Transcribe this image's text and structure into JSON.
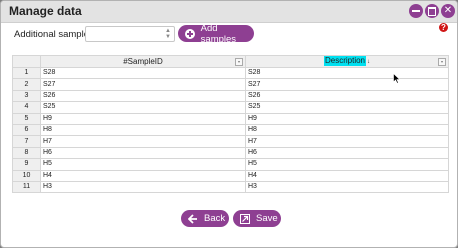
{
  "window": {
    "title": "Manage data"
  },
  "toolbar": {
    "additional_samples_label": "Additional samples:",
    "select_value": "",
    "add_samples_label": "Add samples"
  },
  "grid": {
    "columns": [
      "#SampleID",
      "Description"
    ],
    "sort_indicator": "↓",
    "rows": [
      {
        "index": "1",
        "sample_id": "S28",
        "description": "S28"
      },
      {
        "index": "2",
        "sample_id": "S27",
        "description": "S27"
      },
      {
        "index": "3",
        "sample_id": "S26",
        "description": "S26"
      },
      {
        "index": "4",
        "sample_id": "S25",
        "description": "S25"
      },
      {
        "index": "5",
        "sample_id": "H9",
        "description": "H9"
      },
      {
        "index": "6",
        "sample_id": "H8",
        "description": "H8"
      },
      {
        "index": "7",
        "sample_id": "H7",
        "description": "H7"
      },
      {
        "index": "8",
        "sample_id": "H6",
        "description": "H6"
      },
      {
        "index": "9",
        "sample_id": "H5",
        "description": "H5"
      },
      {
        "index": "10",
        "sample_id": "H4",
        "description": "H4"
      },
      {
        "index": "11",
        "sample_id": "H3",
        "description": "H3"
      }
    ]
  },
  "footer": {
    "back_label": "Back",
    "save_label": "Save"
  },
  "help_glyph": "?",
  "icons": [
    "minimize-icon",
    "maximize-icon",
    "close-icon",
    "help-icon",
    "plus-icon",
    "arrow-left-icon",
    "save-icon",
    "filter-icon",
    "mouse-cursor-icon"
  ],
  "colors": {
    "accent": "#8e3f92",
    "header_highlight": "#00e0f0",
    "help": "#d01515"
  }
}
